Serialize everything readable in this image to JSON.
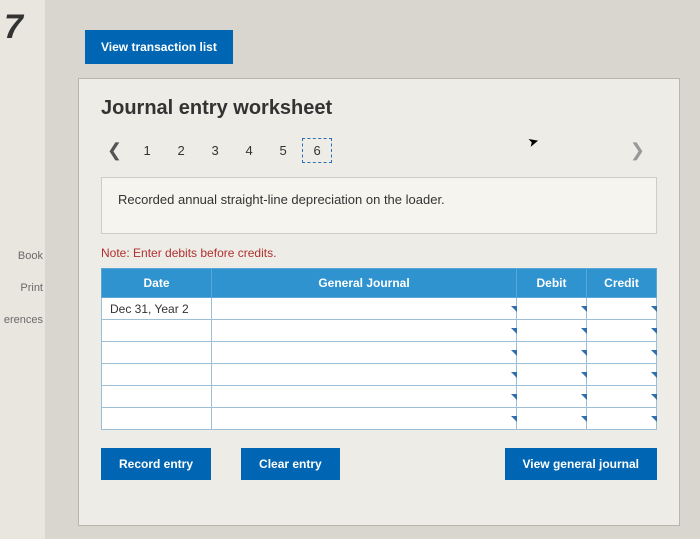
{
  "sidebar": {
    "links": [
      "Book",
      "Print",
      "erences"
    ]
  },
  "buttons": {
    "view_list": "View transaction list",
    "record": "Record entry",
    "clear": "Clear entry",
    "view_general": "View general journal"
  },
  "panel": {
    "title": "Journal entry worksheet",
    "pages": [
      "1",
      "2",
      "3",
      "4",
      "5",
      "6"
    ],
    "active_page": "6",
    "description": "Recorded annual straight-line depreciation on the loader.",
    "note": "Note: Enter debits before credits."
  },
  "table": {
    "headers": {
      "date": "Date",
      "gj": "General Journal",
      "debit": "Debit",
      "credit": "Credit"
    },
    "rows": [
      {
        "date": "Dec 31, Year 2",
        "gj": "",
        "debit": "",
        "credit": ""
      },
      {
        "date": "",
        "gj": "",
        "debit": "",
        "credit": ""
      },
      {
        "date": "",
        "gj": "",
        "debit": "",
        "credit": ""
      },
      {
        "date": "",
        "gj": "",
        "debit": "",
        "credit": ""
      },
      {
        "date": "",
        "gj": "",
        "debit": "",
        "credit": ""
      },
      {
        "date": "",
        "gj": "",
        "debit": "",
        "credit": ""
      }
    ]
  }
}
